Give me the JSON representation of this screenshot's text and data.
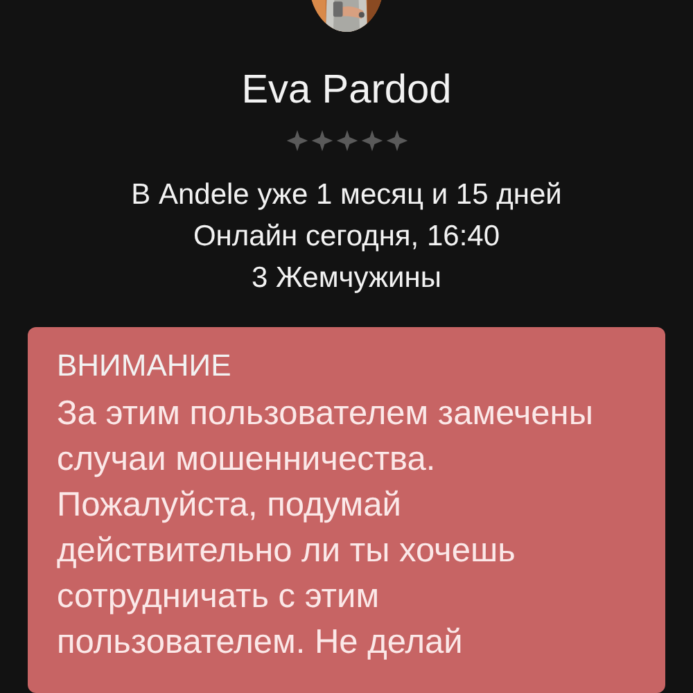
{
  "profile": {
    "name": "Eva Pardod",
    "stars": 0,
    "info": [
      "В Andele уже 1 месяц и 15 дней",
      "Онлайн сегодня, 16:40",
      "3 Жемчужины"
    ]
  },
  "warning": {
    "title": "ВНИМАНИЕ",
    "text": "За этим пользователем замечены случаи мошенничества. Пожалуйста, подумай действительно ли ты хочешь сотрудничать с этим пользователем. Не делай"
  }
}
